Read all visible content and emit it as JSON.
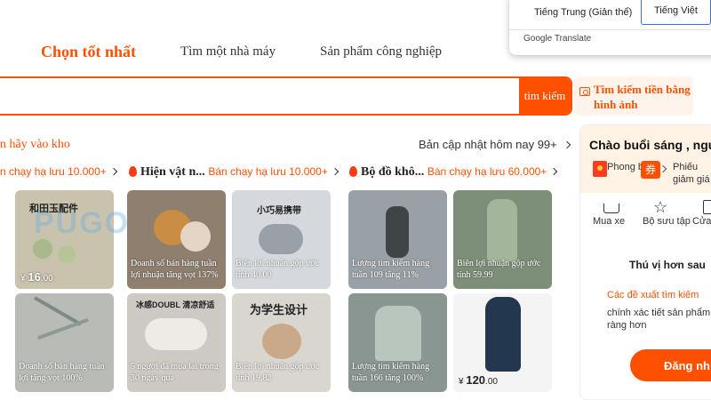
{
  "nav": {
    "tabs": [
      "Chọn tốt nhất",
      "Tìm một nhà máy",
      "Sản phẩm công nghiệp"
    ]
  },
  "search": {
    "value": "",
    "placeholder": "",
    "button_label": "tìm kiếm",
    "image_search_label": "Tìm kiếm tiền bằng hình ảnh"
  },
  "translate": {
    "source_lang": "Tiếng Trung (Giản thể)",
    "target_lang": "Tiếng Việt",
    "provider": "Google Translate"
  },
  "section": {
    "hint": "n hãy vào kho",
    "update_text": "Bản cập nhật hôm nay 99+",
    "segments": [
      {
        "title": "",
        "stat": "n chạy hạ lưu 10.000+"
      },
      {
        "title": "Hiện vật n...",
        "stat": "Bán chạy hạ lưu 10.000+"
      },
      {
        "title": "Bộ đồ khô...",
        "stat": "Bán chạy hạ lưu 60.000+"
      }
    ]
  },
  "cards": [
    {
      "cn": "和田玉配件",
      "o1": "",
      "o2": "",
      "price_sym": "¥",
      "price": "16",
      "price_dec": ".00",
      "bg": "#c9c3ad"
    },
    {
      "cn": "",
      "o1": "Doanh số bán hàng tuần",
      "o2": "lợi nhuận tăng vọt 137%",
      "price_sym": "",
      "price": "",
      "price_dec": "",
      "bg": "#8f7f6f"
    },
    {
      "cn": "小巧易携带",
      "o1": "Biên lợi nhuận gộp ước",
      "o2": "tính 40.00",
      "price_sym": "",
      "price": "",
      "price_dec": "",
      "bg": "#d5d8dc"
    },
    {
      "cn": "",
      "o1": "Lượng tìm kiếm hàng",
      "o2": "tuần 109 tăng 11%",
      "price_sym": "",
      "price": "",
      "price_dec": "",
      "bg": "#9aa1a6"
    },
    {
      "cn": "",
      "o1": "Biên lợi nhuận gộp ước",
      "o2": "tính 59.99",
      "price_sym": "",
      "price": "",
      "price_dec": "",
      "bg": "#7d8e79"
    },
    {
      "cn": "",
      "o1": "Doanh số bán hàng tuần",
      "o2": "lợi tăng vọt 100%",
      "price_sym": "",
      "price": "",
      "price_dec": "",
      "bg": "#b8bbb6"
    },
    {
      "cn": "冰感DOUBL 清凉舒适",
      "o1": "5 người đã mua lại trong",
      "o2": "30 ngày qua",
      "price_sym": "",
      "price": "",
      "price_dec": "",
      "bg": "#cfc9c4"
    },
    {
      "cn": "为学生设计",
      "o1": "Biên lợi nhuận gộp ước",
      "o2": "tính 19.82",
      "price_sym": "",
      "price": "",
      "price_dec": "",
      "bg": "#d9d5cf"
    },
    {
      "cn": "",
      "o1": "Lượng tìm kiếm hàng",
      "o2": "tuần 166 tăng 100%",
      "price_sym": "",
      "price": "",
      "price_dec": "",
      "bg": "#8a9691"
    },
    {
      "cn": "",
      "o1": "",
      "o2": "",
      "price_sym": "¥",
      "price": "120",
      "price_dec": ".00",
      "bg": "#f4f4f4"
    }
  ],
  "panel": {
    "greeting": "Chào buổi sáng , người",
    "red_packet_label": "Phong bì đỏ",
    "coupon_glyph": "券",
    "gift_label": "Phiếu giảm giá",
    "shortcuts": [
      "Mua xe",
      "Bộ sưu tập",
      "Cửa h"
    ],
    "fun_title": "Thú vị hơn sau",
    "recommend_text": "Các đề xuất tìm kiếm",
    "recommend_text2": "chính xác tiết sản phẩm rõ ràng hơn",
    "signup_label": "Đăng nh"
  },
  "watermark": "PUGO",
  "colors": {
    "accent": "#ff5000",
    "panel_bg": "#fff3e6"
  }
}
